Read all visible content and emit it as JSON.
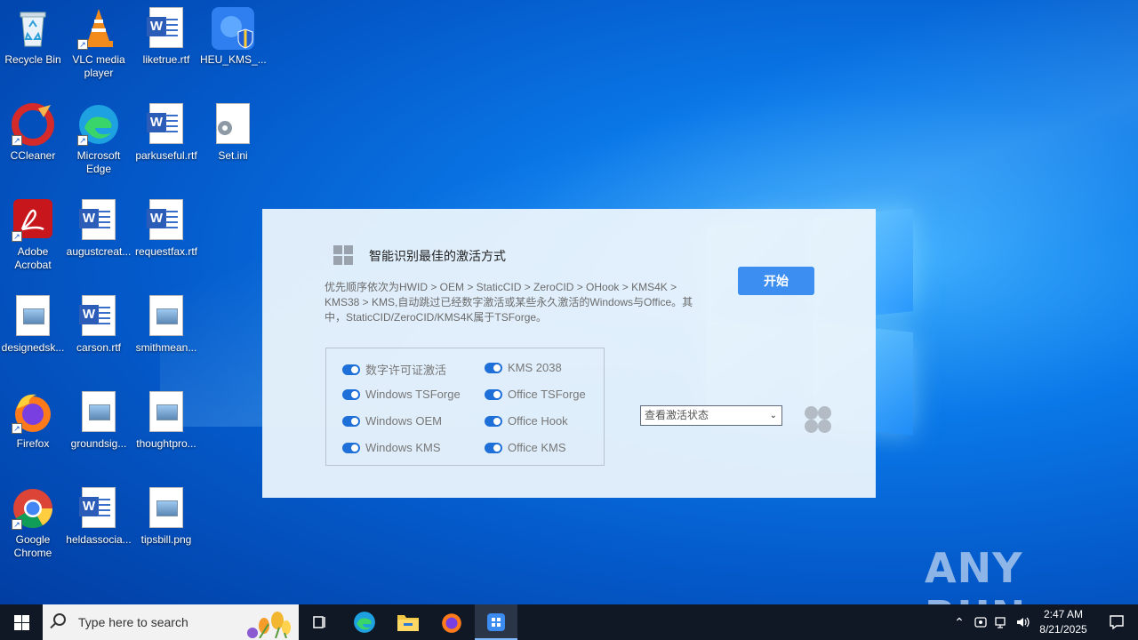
{
  "desktop": {
    "icons": [
      {
        "label": "Recycle Bin"
      },
      {
        "label": "VLC media player"
      },
      {
        "label": "liketrue.rtf"
      },
      {
        "label": "HEU_KMS_..."
      },
      {
        "label": "CCleaner"
      },
      {
        "label": "Microsoft Edge"
      },
      {
        "label": "parkuseful.rtf"
      },
      {
        "label": "Set.ini"
      },
      {
        "label": "Adobe Acrobat"
      },
      {
        "label": "augustcreat..."
      },
      {
        "label": "requestfax.rtf"
      },
      {
        "label": "designedsk..."
      },
      {
        "label": "carson.rtf"
      },
      {
        "label": "smithmean..."
      },
      {
        "label": "Firefox"
      },
      {
        "label": "groundsig..."
      },
      {
        "label": "thoughtpro..."
      },
      {
        "label": "Google Chrome"
      },
      {
        "label": "heldassocia..."
      },
      {
        "label": "tipsbill.png"
      }
    ]
  },
  "app": {
    "title": "智能识别最佳的激活方式",
    "start_label": "开始",
    "description": "优先顺序依次为HWID > OEM > StaticCID > ZeroCID > OHook > KMS4K > KMS38 > KMS,自动跳过已经数字激活或某些永久激活的Windows与Office。其中，StaticCID/ZeroCID/KMS4K属于TSForge。",
    "options_left": [
      "数字许可证激活",
      "Windows TSForge",
      "Windows OEM",
      "Windows KMS"
    ],
    "options_right": [
      "KMS 2038",
      "Office TSForge",
      "Office Hook",
      "Office KMS"
    ],
    "status_select": "查看激活状态",
    "accent_color": "#3c8ef0"
  },
  "watermark": "ANY RUN",
  "taskbar": {
    "search_placeholder": "Type here to search",
    "time": "2:47 AM",
    "date": "8/21/2025"
  }
}
